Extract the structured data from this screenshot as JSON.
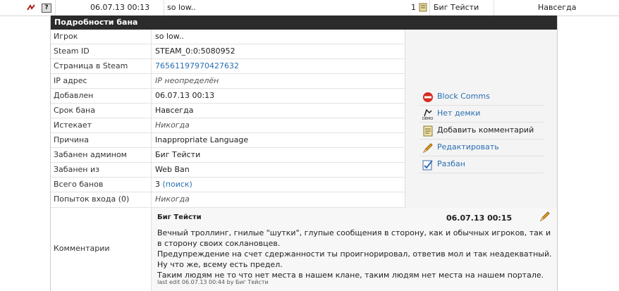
{
  "top_row": {
    "date": "06.07.13 00:13",
    "player": "so low..",
    "demo_count": "1",
    "admin": "Биг Тейсти",
    "length": "Навсегда",
    "question_label": "?"
  },
  "panel": {
    "title": "Подробности бана",
    "rows": [
      {
        "label": "Игрок",
        "value": "so low.."
      },
      {
        "label": "Steam ID",
        "value": "STEAM_0:0:5080952"
      },
      {
        "label": "Страница в Steam",
        "value": "76561197970427632"
      },
      {
        "label": "IP адрес",
        "value": "IP неопределён"
      },
      {
        "label": "Добавлен",
        "value": "06.07.13 00:13"
      },
      {
        "label": "Срок бана",
        "value": "Навсегда"
      },
      {
        "label": "Истекает",
        "value": "Никогда"
      },
      {
        "label": "Причина",
        "value": "Inappropriate Language"
      },
      {
        "label": "Забанен админом",
        "value": "Биг Тейсти"
      },
      {
        "label": "Забанен из",
        "value": "Web Ban"
      },
      {
        "label": "Всего банов",
        "value": "3",
        "extra": "(поиск)"
      },
      {
        "label": "Попыток входа (0)",
        "value": "Никогда"
      }
    ],
    "comments_label": "Комментарии"
  },
  "actions": [
    {
      "label": "Block Comms",
      "icon": "block-icon"
    },
    {
      "label": "Нет демки",
      "icon": "demo-icon"
    },
    {
      "label": "Добавить комментарий",
      "icon": "comment-icon"
    },
    {
      "label": "Редактировать",
      "icon": "pencil-icon"
    },
    {
      "label": "Разбан",
      "icon": "unban-icon"
    }
  ],
  "comment": {
    "author": "Биг Тейсти",
    "date": "06.07.13 00:15",
    "lines": [
      "Вечный троллинг, гнилые \"шутки\", глупые сообщения в сторону, как и обычных игроков, так и в сторону своих соклановцев.",
      "Предупреждение на счет сдержанности ты проигнорировал, ответив мол и так неадекватный. Ну что же, всему есть предел.",
      "Таким людям не то что нет места в нашем клане, таким людям нет места на нашем портале."
    ],
    "edit_note": "last edit 06.07.13 00:44 by Биг Тейсти"
  },
  "colors": {
    "header_bg": "#2b2b2b",
    "link": "#2a6fb0",
    "sidebar_bg": "#f4f4f4"
  }
}
